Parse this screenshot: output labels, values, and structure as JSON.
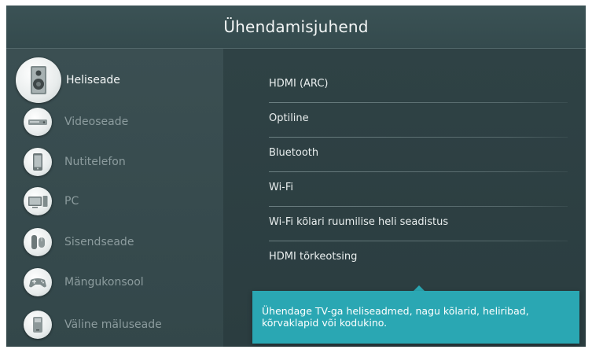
{
  "header": {
    "title": "Ühendamisjuhend"
  },
  "categories": [
    {
      "label": "Heliseade",
      "icon": "speaker-icon",
      "selected": true
    },
    {
      "label": "Videoseade",
      "icon": "video-player-icon",
      "selected": false
    },
    {
      "label": "Nutitelefon",
      "icon": "smartphone-icon",
      "selected": false
    },
    {
      "label": "PC",
      "icon": "pc-icon",
      "selected": false
    },
    {
      "label": "Sisendseade",
      "icon": "input-device-icon",
      "selected": false
    },
    {
      "label": "Mängukonsool",
      "icon": "game-controller-icon",
      "selected": false
    },
    {
      "label": "Väline mäluseade",
      "icon": "external-storage-icon",
      "selected": false
    }
  ],
  "options": [
    {
      "label": "HDMI (ARC)"
    },
    {
      "label": "Optiline"
    },
    {
      "label": "Bluetooth"
    },
    {
      "label": "Wi-Fi"
    },
    {
      "label": "Wi-Fi kõlari ruumilise heli seadistus"
    },
    {
      "label": "HDMI tõrkeotsing"
    }
  ],
  "tooltip": {
    "text": "Ühendage TV-ga heliseadmed, nagu kõlarid, heliribad, kõrvaklapid või kodukino."
  },
  "colors": {
    "background": "#2f4245",
    "tooltip": "#2aa7b3",
    "text_primary": "#f4f7f7",
    "text_dim": "#8c9c9e"
  }
}
